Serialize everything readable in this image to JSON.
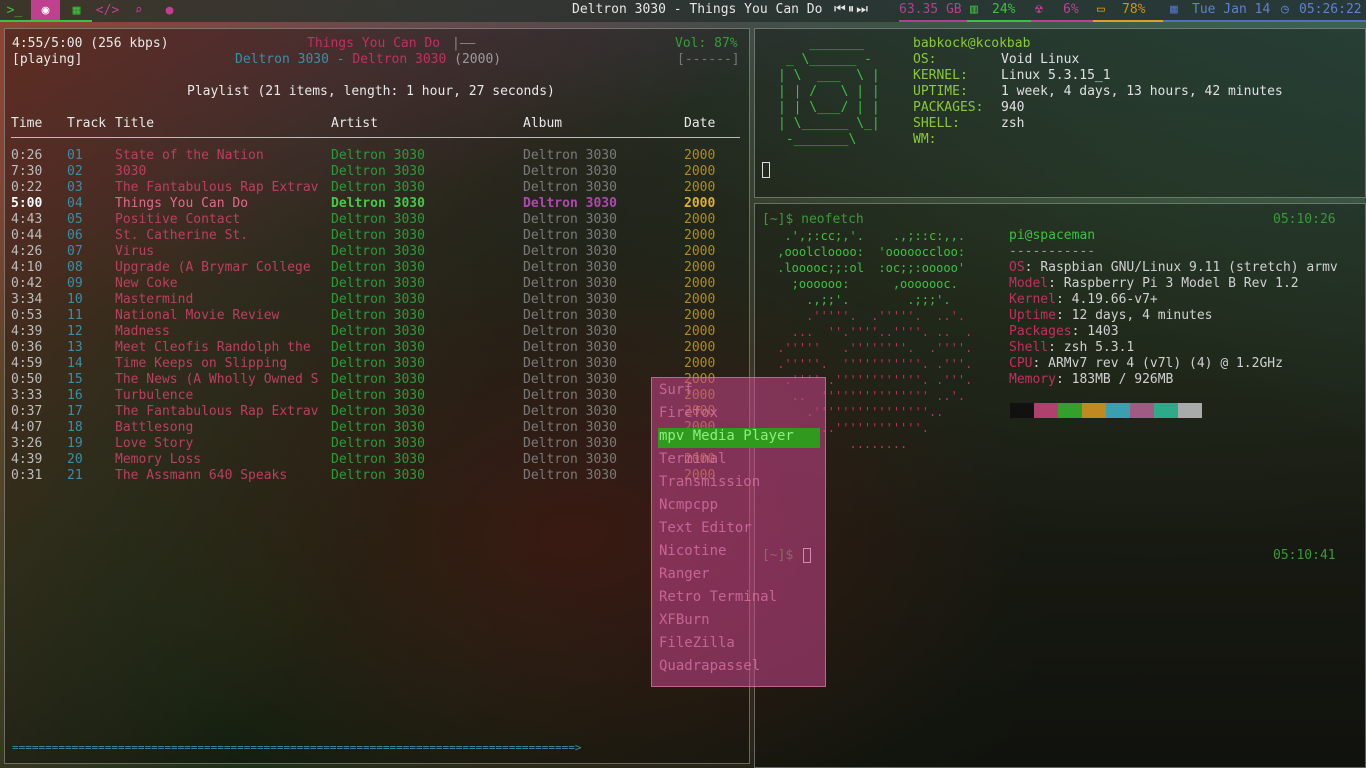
{
  "topbar": {
    "workspaces": [
      {
        "icon": "terminal-icon",
        "glyph": ">_",
        "color": "#3ec040"
      },
      {
        "icon": "firefox-icon",
        "glyph": "◉",
        "color": "#c040a0"
      },
      {
        "icon": "grid-icon",
        "glyph": "▦",
        "color": "#3ec040"
      },
      {
        "icon": "code-icon",
        "glyph": "</>",
        "color": "#c04090"
      },
      {
        "icon": "search-icon",
        "glyph": "⌕",
        "color": "#c04090"
      },
      {
        "icon": "chat-icon",
        "glyph": "●",
        "color": "#c04090"
      }
    ],
    "now_playing": "Deltron 3030 - Things You Can Do",
    "media_controls": {
      "prev": "⏮",
      "pause": "⏸",
      "next": "⏭"
    },
    "disk": "63.35 GB",
    "memory": "24%",
    "cpu": "6%",
    "battery": "78%",
    "date": "Tue Jan 14",
    "time": "05:26:22"
  },
  "ncmpcpp": {
    "position": "4:55/5:00 (256 kbps)",
    "state": "[playing]",
    "song_title": "Things You Can Do",
    "song_artist": "Deltron 3030",
    "song_sep": " - ",
    "song_album": "Deltron 3030",
    "song_year": "(2000)",
    "volume": "Vol: 87%",
    "progress_fraction": 0.983,
    "playlist_header": "Playlist (21 items, length: 1 hour, 27 seconds)",
    "columns": {
      "time": "Time",
      "track": "Track",
      "title": "Title",
      "artist": "Artist",
      "album": "Album",
      "date": "Date"
    },
    "current_index": 3,
    "tracks": [
      {
        "time": "0:26",
        "track": "01",
        "title": "State of the Nation",
        "artist": "Deltron 3030",
        "album": "Deltron 3030",
        "date": "2000"
      },
      {
        "time": "7:30",
        "track": "02",
        "title": "3030",
        "artist": "Deltron 3030",
        "album": "Deltron 3030",
        "date": "2000"
      },
      {
        "time": "0:22",
        "track": "03",
        "title": "The Fantabulous Rap Extrav",
        "artist": "Deltron 3030",
        "album": "Deltron 3030",
        "date": "2000"
      },
      {
        "time": "5:00",
        "track": "04",
        "title": "Things You Can Do",
        "artist": "Deltron 3030",
        "album": "Deltron 3030",
        "date": "2000"
      },
      {
        "time": "4:43",
        "track": "05",
        "title": "Positive Contact",
        "artist": "Deltron 3030",
        "album": "Deltron 3030",
        "date": "2000"
      },
      {
        "time": "0:44",
        "track": "06",
        "title": "St. Catherine St.",
        "artist": "Deltron 3030",
        "album": "Deltron 3030",
        "date": "2000"
      },
      {
        "time": "4:26",
        "track": "07",
        "title": "Virus",
        "artist": "Deltron 3030",
        "album": "Deltron 3030",
        "date": "2000"
      },
      {
        "time": "4:10",
        "track": "08",
        "title": "Upgrade (A Brymar College",
        "artist": "Deltron 3030",
        "album": "Deltron 3030",
        "date": "2000"
      },
      {
        "time": "0:42",
        "track": "09",
        "title": "New Coke",
        "artist": "Deltron 3030",
        "album": "Deltron 3030",
        "date": "2000"
      },
      {
        "time": "3:34",
        "track": "10",
        "title": "Mastermind",
        "artist": "Deltron 3030",
        "album": "Deltron 3030",
        "date": "2000"
      },
      {
        "time": "0:53",
        "track": "11",
        "title": "National Movie Review",
        "artist": "Deltron 3030",
        "album": "Deltron 3030",
        "date": "2000"
      },
      {
        "time": "4:39",
        "track": "12",
        "title": "Madness",
        "artist": "Deltron 3030",
        "album": "Deltron 3030",
        "date": "2000"
      },
      {
        "time": "0:36",
        "track": "13",
        "title": "Meet Cleofis Randolph the",
        "artist": "Deltron 3030",
        "album": "Deltron 3030",
        "date": "2000"
      },
      {
        "time": "4:59",
        "track": "14",
        "title": "Time Keeps on Slipping",
        "artist": "Deltron 3030",
        "album": "Deltron 3030",
        "date": "2000"
      },
      {
        "time": "0:50",
        "track": "15",
        "title": "The News (A Wholly Owned S",
        "artist": "Deltron 3030",
        "album": "Deltron 3030",
        "date": "2000"
      },
      {
        "time": "3:33",
        "track": "16",
        "title": "Turbulence",
        "artist": "Deltron 3030",
        "album": "Deltron 3030",
        "date": "2000"
      },
      {
        "time": "0:37",
        "track": "17",
        "title": "The Fantabulous Rap Extrav",
        "artist": "Deltron 3030",
        "album": "Deltron 3030",
        "date": "2000"
      },
      {
        "time": "4:07",
        "track": "18",
        "title": "Battlesong",
        "artist": "Deltron 3030",
        "album": "Deltron 3030",
        "date": "2000"
      },
      {
        "time": "3:26",
        "track": "19",
        "title": "Love Story",
        "artist": "Deltron 3030",
        "album": "Deltron 3030",
        "date": "2000"
      },
      {
        "time": "4:39",
        "track": "20",
        "title": "Memory Loss",
        "artist": "Deltron 3030",
        "album": "Deltron 3030",
        "date": "2000"
      },
      {
        "time": "0:31",
        "track": "21",
        "title": "The Assmann 640 Speaks",
        "artist": "Deltron 3030",
        "album": "Deltron 3030",
        "date": "2000"
      }
    ],
    "progress_bar": "=====================================================================================>"
  },
  "neofetch_void": {
    "logo": [
      "    _______",
      " _ \\______ -",
      "| \\  ___  \\ |",
      "| | /   \\ | |",
      "| | \\___/ | |",
      "| \\______ \\_|",
      " -_______\\"
    ],
    "userhost": "babkock@kcokbab",
    "fields": [
      {
        "key": "OS:",
        "value": "Void Linux"
      },
      {
        "key": "KERNEL:",
        "value": "Linux 5.3.15_1"
      },
      {
        "key": "UPTIME:",
        "value": "1 week, 4 days, 13 hours, 42 minutes"
      },
      {
        "key": "PACKAGES:",
        "value": "940"
      },
      {
        "key": "SHELL:",
        "value": "zsh"
      },
      {
        "key": "WM:",
        "value": ""
      }
    ]
  },
  "neofetch_pi": {
    "prompt": "[~]$ neofetch",
    "time1": "05:10:26",
    "logo": [
      "  .',;:cc;,'.    .,;::c:,,.",
      " ,ooolcloooo:  'oooooccloo:",
      " .looooc;;:ol  :oc;;:ooooo'",
      "   ;oooooo:      ,ooooooc.",
      "     .,;;'.        .;;;'.",
      "     .'''''.  .'''''.  ..'.",
      "   ...  ''.''''..''''. ..  .",
      " .'''''   .''''''''.  .''''.",
      " .'''''.  '''''''''''. .'''.",
      "  .'''' .''''''''''''. .'''.",
      "   ..  ''''''''''''''' ..'.",
      "     .''''''''''''''''..",
      "       ..''''''''''''.",
      "           ........"
    ],
    "userhost": "pi@spaceman",
    "separator": "-----------",
    "fields": [
      {
        "key": "OS",
        "value": "Raspbian GNU/Linux 9.11 (stretch) armv"
      },
      {
        "key": "Model",
        "value": "Raspberry Pi 3 Model B Rev 1.2"
      },
      {
        "key": "Kernel",
        "value": "4.19.66-v7+"
      },
      {
        "key": "Uptime",
        "value": "12 days, 4 minutes"
      },
      {
        "key": "Packages",
        "value": "1403"
      },
      {
        "key": "Shell",
        "value": "zsh 5.3.1"
      },
      {
        "key": "CPU",
        "value": "ARMv7 rev 4 (v7l) (4) @ 1.2GHz"
      },
      {
        "key": "Memory",
        "value": "183MB / 926MB"
      }
    ],
    "palette": [
      "#111111",
      "#b0406e",
      "#34a02c",
      "#c08a20",
      "#3aa0b0",
      "#a05a84",
      "#2eaa88",
      "#aaaaaa"
    ],
    "prompt2": "[~]$",
    "time2": "05:10:41"
  },
  "launcher": {
    "items": [
      "Surf",
      "Firefox",
      "mpv Media Player",
      "Terminal",
      "Transmission",
      "Ncmpcpp",
      "Text Editor",
      "Nicotine",
      "Ranger",
      "Retro Terminal",
      "XFBurn",
      "FileZilla",
      "Quadrapassel"
    ],
    "selected": 2
  }
}
